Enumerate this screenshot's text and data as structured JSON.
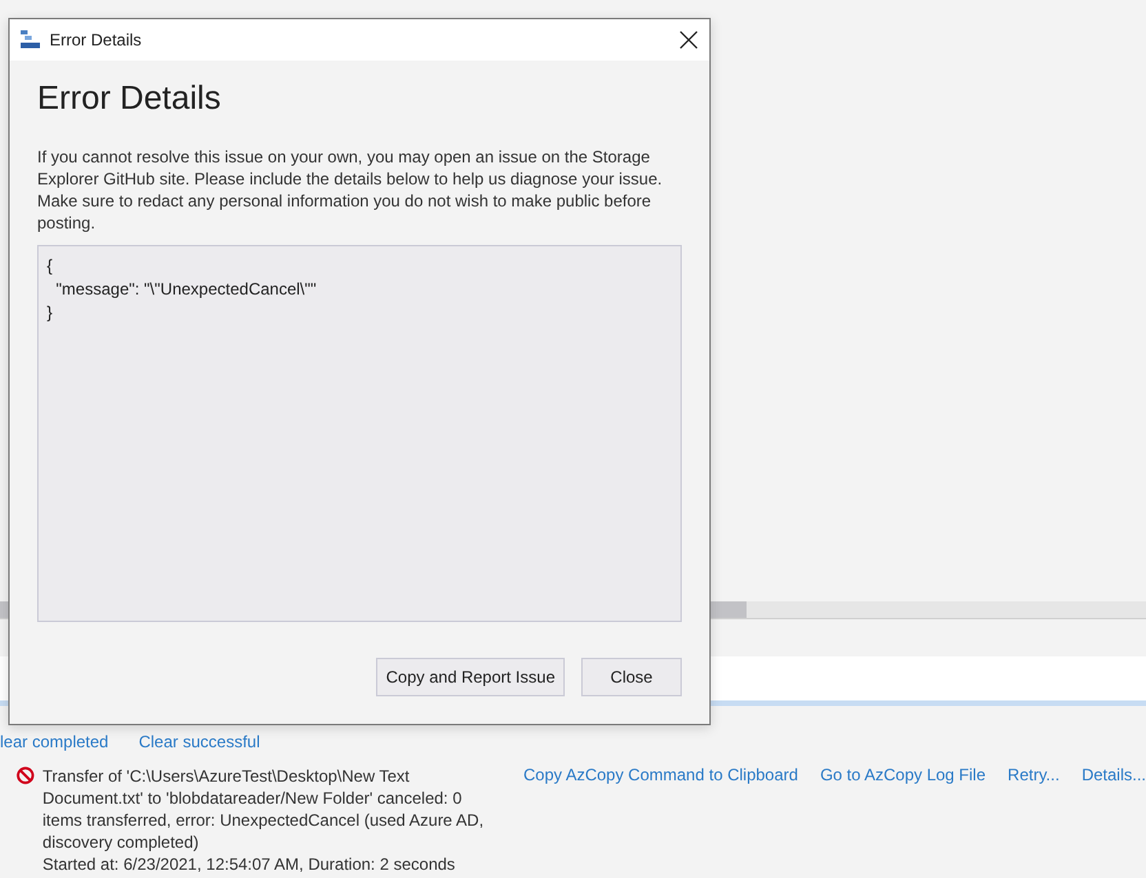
{
  "dialog": {
    "title": "Error Details",
    "heading": "Error Details",
    "description": "If you cannot resolve this issue on your own, you may open an issue on the Storage Explorer GitHub site. Please include the details below to help us diagnose your issue. Make sure to redact any personal information you do not wish to make public before posting.",
    "details": "{\n  \"message\": \"\\\"UnexpectedCancel\\\"\"\n}",
    "buttons": [
      "Copy and Report Issue",
      "Close"
    ]
  },
  "activity": {
    "clear_links": [
      "lear completed",
      "Clear successful"
    ],
    "items": [
      {
        "kind": "error",
        "text": "Transfer of 'C:\\Users\\AzureTest\\Desktop\\New Text Document.txt' to 'blobdatareader/New Folder' canceled: 0 items transferred, error: UnexpectedCancel (used Azure AD, discovery completed)",
        "started": "Started at: 6/23/2021, 12:54:07 AM, Duration: 2 seconds",
        "actions": [
          "Copy AzCopy Command to Clipboard",
          "Go to AzCopy Log File",
          "Retry...",
          "Details..."
        ]
      }
    ]
  }
}
